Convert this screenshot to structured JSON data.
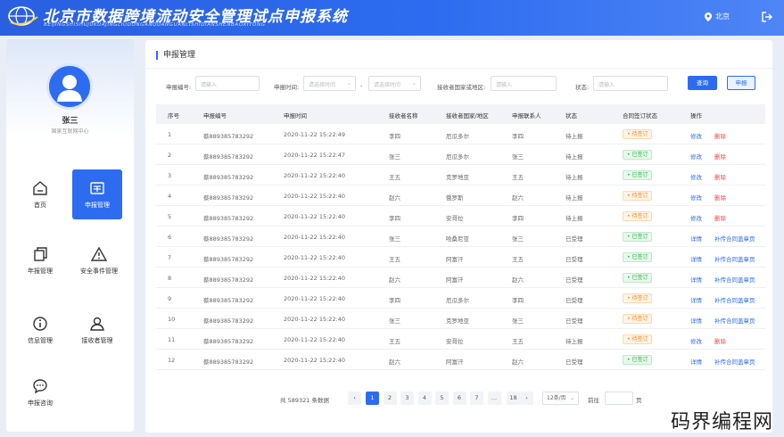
{
  "app": {
    "title": "北京市数据跨境流动安全管理试点申报系统",
    "subtitle": "BEIJINGSHISHUJUKUAJINGLIUDONGANQUANGUANLISHIDIANSHENBAOXITONG",
    "location": "北京",
    "logo_icon": "globe-logo-icon"
  },
  "user": {
    "name": "张三",
    "org": "国家互联网中心"
  },
  "nav": [
    {
      "label": "首页",
      "icon": "home-icon",
      "active": false
    },
    {
      "label": "申报管理",
      "icon": "declaration-icon",
      "active": true
    },
    {
      "label": "年报管理",
      "icon": "annual-report-icon",
      "active": false
    },
    {
      "label": "安全事件管理",
      "icon": "warning-icon",
      "active": false
    },
    {
      "label": "信息管理",
      "icon": "info-icon",
      "active": false
    },
    {
      "label": "接收者管理",
      "icon": "user-icon",
      "active": false
    },
    {
      "label": "申报咨询",
      "icon": "chat-icon",
      "active": false
    }
  ],
  "page": {
    "title": "申报管理"
  },
  "filters": {
    "id_label": "申报编号:",
    "id_placeholder": "请输入",
    "time_label": "申报时间:",
    "start_placeholder": "请选择时间",
    "end_placeholder": "请选择时间",
    "range_sep": "-",
    "region_label": "接收者国家或地区:",
    "region_placeholder": "请输入",
    "status_label": "状态:",
    "status_placeholder": "请输入",
    "query_btn": "查询",
    "declare_btn": "申报"
  },
  "table": {
    "columns": [
      "序号",
      "申报编号",
      "申报时间",
      "接收者名称",
      "接收者国家/地区",
      "申报联系人",
      "状态",
      "合同签订状态",
      "操作"
    ],
    "rows": [
      {
        "no": "1",
        "id": "蔡889385783292",
        "time": "2020-11-22   15:22:49",
        "receiver": "李四",
        "region": "厄瓜多尔",
        "contact": "李四",
        "status": "待上报",
        "sign": "• 待签订",
        "signed": false,
        "a1": "修改",
        "a2": "删除"
      },
      {
        "no": "2",
        "id": "蔡889385783292",
        "time": "2020-11-22   15:22:47",
        "receiver": "张三",
        "region": "厄瓜多尔",
        "contact": "张三",
        "status": "待上报",
        "sign": "• 已签订",
        "signed": true,
        "a1": "修改",
        "a2": "删除"
      },
      {
        "no": "3",
        "id": "蔡889385783292",
        "time": "2020-11-22   15:22:40",
        "receiver": "王五",
        "region": "克罗地亚",
        "contact": "王五",
        "status": "待上报",
        "sign": "• 已签订",
        "signed": true,
        "a1": "修改",
        "a2": "删除"
      },
      {
        "no": "4",
        "id": "蔡889385783292",
        "time": "2020-11-22   15:22:40",
        "receiver": "赵六",
        "region": "俄罗斯",
        "contact": "赵六",
        "status": "待上报",
        "sign": "• 待签订",
        "signed": false,
        "a1": "修改",
        "a2": "删除"
      },
      {
        "no": "5",
        "id": "蔡889385783292",
        "time": "2020-11-22   15:22:40",
        "receiver": "李四",
        "region": "安哥拉",
        "contact": "李四",
        "status": "待上报",
        "sign": "• 待签订",
        "signed": false,
        "a1": "修改",
        "a2": "删除"
      },
      {
        "no": "6",
        "id": "蔡889385783292",
        "time": "2020-11-22   15:22:40",
        "receiver": "张三",
        "region": "哈桑尼亚",
        "contact": "张三",
        "status": "已受理",
        "sign": "• 已签订",
        "signed": true,
        "a1": "详情",
        "a2": "补传合同盖章页"
      },
      {
        "no": "7",
        "id": "蔡889385783292",
        "time": "2020-11-22   15:22:40",
        "receiver": "王五",
        "region": "阿富汗",
        "contact": "王五",
        "status": "已受理",
        "sign": "• 已签订",
        "signed": true,
        "a1": "详情",
        "a2": "补传合同盖章页"
      },
      {
        "no": "8",
        "id": "蔡889385783292",
        "time": "2020-11-22   15:22:40",
        "receiver": "赵六",
        "region": "阿富汗",
        "contact": "赵六",
        "status": "已受理",
        "sign": "• 已签订",
        "signed": true,
        "a1": "详情",
        "a2": "补传合同盖章页"
      },
      {
        "no": "9",
        "id": "蔡889385783292",
        "time": "2020-11-22   15:22:40",
        "receiver": "李四",
        "region": "厄瓜多尔",
        "contact": "李四",
        "status": "已受理",
        "sign": "• 待签订",
        "signed": false,
        "a1": "详情",
        "a2": "补传合同盖章页"
      },
      {
        "no": "10",
        "id": "蔡889385783292",
        "time": "2020-11-22   15:22:40",
        "receiver": "张三",
        "region": "克罗地亚",
        "contact": "张三",
        "status": "已受理",
        "sign": "• 待签订",
        "signed": false,
        "a1": "详情",
        "a2": "补传合同盖章页"
      },
      {
        "no": "11",
        "id": "蔡889385783292",
        "time": "2020-11-22   15:22:40",
        "receiver": "王五",
        "region": "安哥拉",
        "contact": "王五",
        "status": "待上报",
        "sign": "• 待签订",
        "signed": false,
        "a1": "修改",
        "a2": "删除"
      },
      {
        "no": "12",
        "id": "蔡889385783292",
        "time": "2020-11-22   15:22:40",
        "receiver": "赵六",
        "region": "阿富汗",
        "contact": "赵六",
        "status": "已受理",
        "sign": "• 已签订",
        "signed": true,
        "a1": "详情",
        "a2": "补传合同盖章页"
      }
    ]
  },
  "pager": {
    "total": "共 589321 条数据",
    "prev": "‹",
    "pages": [
      "1",
      "2",
      "3",
      "4",
      "5",
      "6",
      "7",
      "...",
      "18"
    ],
    "current": "1",
    "next": "›",
    "page_size": "12条/页",
    "goto": "前往",
    "unit": "页"
  },
  "watermark": "码界编程网",
  "colors": {
    "primary": "#2d6cf0",
    "danger": "#f04848",
    "success": "#2bb14c",
    "warning": "#f08a1a"
  }
}
